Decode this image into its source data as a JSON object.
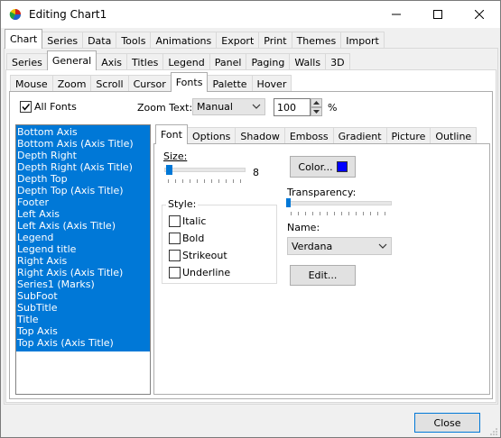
{
  "window": {
    "title": "Editing Chart1"
  },
  "tabs": {
    "top": [
      "Chart",
      "Series",
      "Data",
      "Tools",
      "Animations",
      "Export",
      "Print",
      "Themes",
      "Import"
    ],
    "second": [
      "Series",
      "General",
      "Axis",
      "Titles",
      "Legend",
      "Panel",
      "Paging",
      "Walls",
      "3D"
    ],
    "third": [
      "Mouse",
      "Zoom",
      "Scroll",
      "Cursor",
      "Fonts",
      "Palette",
      "Hover"
    ],
    "font": [
      "Font",
      "Options",
      "Shadow",
      "Emboss",
      "Gradient",
      "Picture",
      "Outline"
    ]
  },
  "fonts_page": {
    "all_fonts_label": "All Fonts",
    "zoom_text_label": "Zoom Text:",
    "zoom_mode": "Manual",
    "zoom_value": "100",
    "zoom_unit": "%"
  },
  "font_list": [
    "Bottom Axis",
    "Bottom Axis (Axis Title)",
    "Depth Right",
    "Depth Right (Axis Title)",
    "Depth Top",
    "Depth Top (Axis Title)",
    "Footer",
    "Left Axis",
    "Left Axis (Axis Title)",
    "Legend",
    "Legend title",
    "Right Axis",
    "Right Axis (Axis Title)",
    "Series1 (Marks)",
    "SubFoot",
    "SubTitle",
    "Title",
    "Top Axis",
    "Top Axis (Axis Title)"
  ],
  "font_tab": {
    "size_label": "Size:",
    "size_value": "8",
    "style_label": "Style:",
    "styles": [
      "Italic",
      "Bold",
      "Strikeout",
      "Underline"
    ],
    "color_button": "Color...",
    "color_swatch": "#0000ff",
    "transparency_label": "Transparency:",
    "name_label": "Name:",
    "name_value": "Verdana",
    "edit_button": "Edit..."
  },
  "footer": {
    "close_button": "Close"
  },
  "colors": {
    "selection": "#0078d7",
    "accent": "#0078d7"
  }
}
